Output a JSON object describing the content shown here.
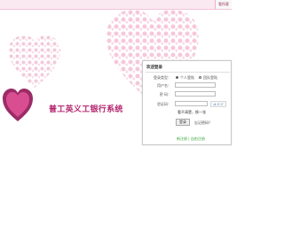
{
  "top_bar": {
    "link": "看所客"
  },
  "brand": {
    "logo_text": "普工宝",
    "title": "普工英义工银行系统"
  },
  "login": {
    "title": "欢迎登录",
    "fields": {
      "login_type": "登录类型：",
      "personal": "个人登陆",
      "group": "团队登陆",
      "account": "用户名：",
      "password": "密 码：",
      "captcha": "验证码："
    },
    "captcha_text": "A 0 C",
    "captcha_hint": "看不清楚，换一张",
    "login_button": "登录",
    "forgot": "忘记密码？",
    "footer": "新注册   |   自由注册"
  }
}
